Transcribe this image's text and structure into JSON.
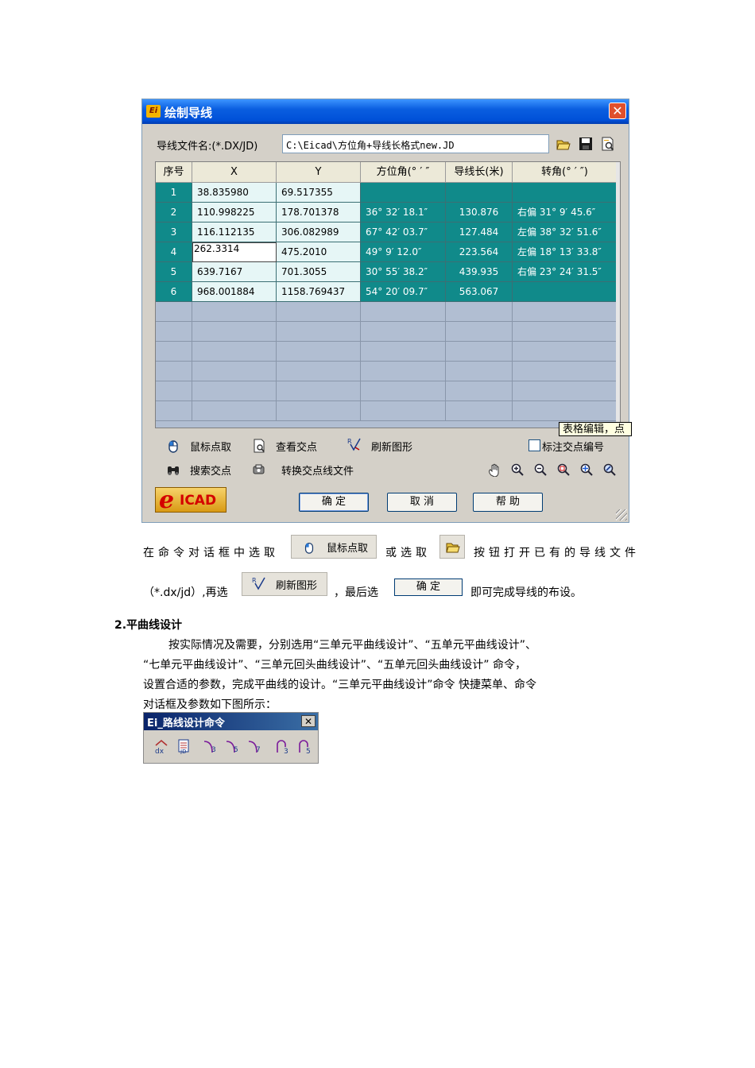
{
  "dialog": {
    "title": "绘制导线",
    "app_icon_text": "Ei",
    "file_label": "导线文件名:(*.DX/JD)",
    "file_value": "C:\\Eicad\\方位角+导线长格式new.JD",
    "columns": [
      "序号",
      "X",
      "Y",
      "方位角(° ′ ″",
      "导线长(米)",
      "转角(° ′ ″)"
    ],
    "rows": [
      [
        "1",
        "38.835980",
        "69.517355",
        "",
        "",
        ""
      ],
      [
        "2",
        "110.998225",
        "178.701378",
        "36° 32′ 18.1″",
        "130.876",
        "右偏 31° 9′ 45.6″"
      ],
      [
        "3",
        "116.112135",
        "306.082989",
        "67° 42′ 03.7″",
        "127.484",
        "左偏 38° 32′ 51.6″"
      ],
      [
        "4",
        "262.3314",
        "475.2010",
        "49° 9′ 12.0″",
        "223.564",
        "左偏 18° 13′ 33.8″"
      ],
      [
        "5",
        "639.7167",
        "701.3055",
        "30° 55′ 38.2″",
        "439.935",
        "右偏 23° 24′ 31.5″"
      ],
      [
        "6",
        "968.001884",
        "1158.769437",
        "54° 20′ 09.7″",
        "563.067",
        ""
      ]
    ],
    "tooltip": "表格编辑，点",
    "actions": {
      "pick": "鼠标点取",
      "view": "查看交点",
      "refresh": "刷新图形",
      "search": "搜索交点",
      "convert": "转换交点线文件",
      "mark_checkbox": "标注交点编号"
    },
    "buttons": {
      "ok": "确 定",
      "cancel": "取 消",
      "help": "帮 助"
    },
    "logo": {
      "e": "e",
      "text": "ICAD"
    }
  },
  "body": {
    "line1_a": "在命令对话框中选取",
    "inline_pick": "鼠标点取",
    "line1_b": "或选取",
    "line1_c": "按钮打开已有的导线文件",
    "line2_a": "（*.dx/jd）,再选",
    "inline_refresh": "刷新图形",
    "line2_b": "，最后选",
    "inline_ok": "确 定",
    "line2_c": "即可完成导线的布设。",
    "heading": "2.平曲线设计",
    "para_l1": "按实际情况及需要，分别选用“三单元平曲线设计”、“五单元平曲线设计”、",
    "para_l2": "“七单元平曲线设计”、“三单元回头曲线设计”、“五单元回头曲线设计” 命令，",
    "para_l3": "设置合适的参数，完成平曲线的设计。“三单元平曲线设计”命令 快捷菜单、命令",
    "para_l4": "对话框及参数如下图所示："
  },
  "toolbar2": {
    "title": "Ei_路线设计命令",
    "icons": [
      "dx-icon",
      "jd-icon",
      "curve-3-icon",
      "curve-5-icon",
      "curve-7-icon",
      "hairpin-3-icon",
      "hairpin-5-icon"
    ]
  },
  "colors": {
    "titlebar": "#0a5ee0",
    "grid_selected": "#108a8a",
    "grid_empty": "#b1bed2"
  }
}
